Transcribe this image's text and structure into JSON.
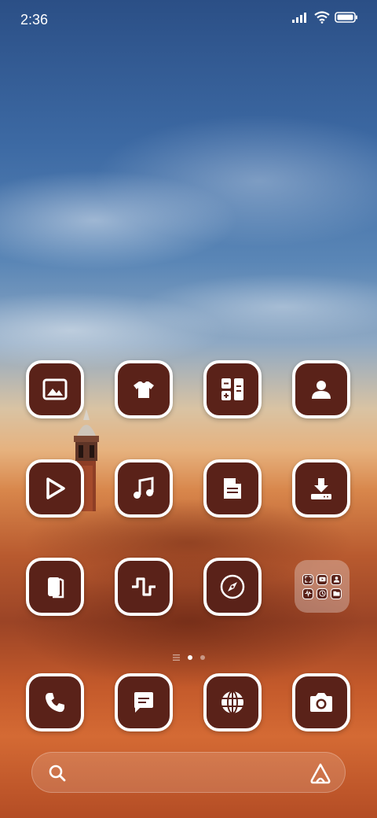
{
  "status_bar": {
    "time": "2:36",
    "icons": [
      "cellular-signal-icon",
      "wifi-icon",
      "battery-icon"
    ]
  },
  "theme": {
    "icon_background": "#5a2219",
    "icon_border": "#ffffff"
  },
  "home_grid": [
    {
      "icon": "gallery-icon"
    },
    {
      "icon": "themes-icon"
    },
    {
      "icon": "calculator-icon"
    },
    {
      "icon": "contacts-icon"
    },
    {
      "icon": "video-player-icon"
    },
    {
      "icon": "music-icon"
    },
    {
      "icon": "notes-icon"
    },
    {
      "icon": "downloads-icon"
    },
    {
      "icon": "wallet-icon"
    },
    {
      "icon": "pulse-icon"
    },
    {
      "icon": "compass-icon"
    }
  ],
  "folder": {
    "mini_icons": [
      "scanner-icon",
      "youtube-icon",
      "profile-icon",
      "sound-recorder-icon",
      "clock-icon",
      "file-manager-icon"
    ]
  },
  "page_indicator": {
    "pages": 2,
    "active": 1
  },
  "dock": [
    {
      "icon": "phone-icon"
    },
    {
      "icon": "messages-icon"
    },
    {
      "icon": "browser-icon"
    },
    {
      "icon": "camera-icon"
    }
  ],
  "search_bar": {
    "left_icon": "search-icon",
    "right_icon": "assistant-icon"
  }
}
